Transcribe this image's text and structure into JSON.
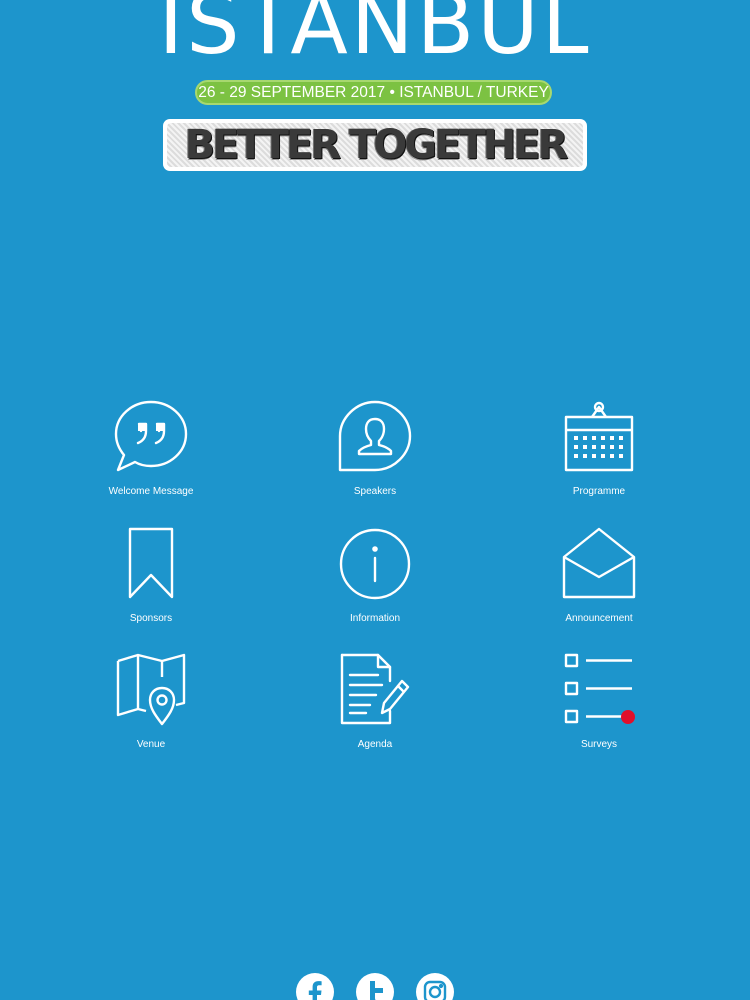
{
  "header": {
    "title": "ISTANBUL",
    "date_line": "26 - 29 SEPTEMBER 2017 • ISTANBUL / TURKEY",
    "slogan": "BETTER TOGETHER"
  },
  "menu": {
    "items": [
      {
        "label": "Welcome Message",
        "icon": "speech-bubble-quote-icon"
      },
      {
        "label": "Speakers",
        "icon": "speaker-person-icon"
      },
      {
        "label": "Programme",
        "icon": "calendar-icon"
      },
      {
        "label": "Sponsors",
        "icon": "bookmark-ribbon-icon"
      },
      {
        "label": "Information",
        "icon": "info-icon"
      },
      {
        "label": "Announcement",
        "icon": "envelope-icon"
      },
      {
        "label": "Venue",
        "icon": "map-pin-icon"
      },
      {
        "label": "Agenda",
        "icon": "document-pencil-icon"
      },
      {
        "label": "Surveys",
        "icon": "checklist-icon"
      }
    ]
  },
  "social": [
    "facebook-icon",
    "twitter-icon",
    "instagram-icon"
  ],
  "colors": {
    "background": "#1d95cc",
    "date_pill": "#7cc242",
    "survey_badge": "#e0102c",
    "icon_stroke": "#ffffff"
  }
}
